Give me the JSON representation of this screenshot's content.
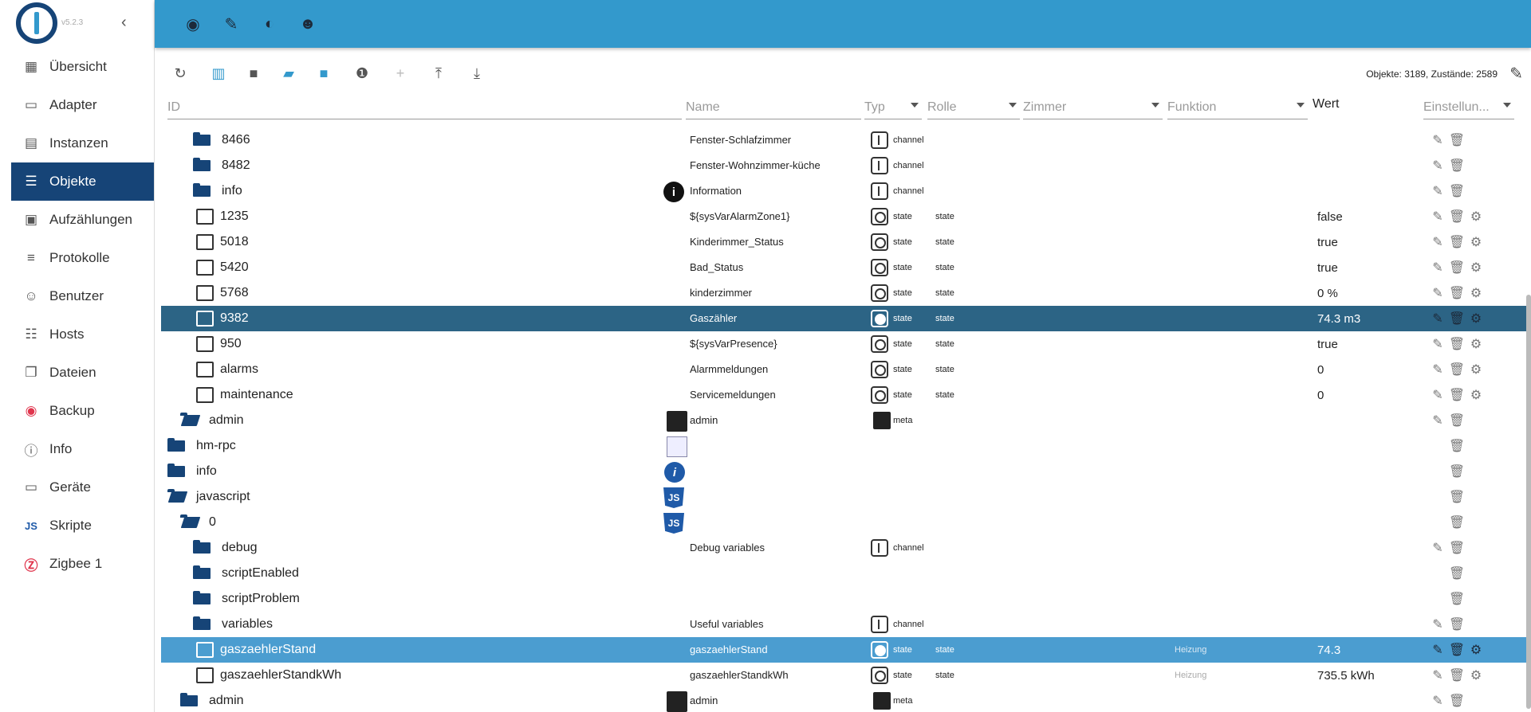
{
  "app": {
    "version": "v5.2.3"
  },
  "sidebar": {
    "items": [
      {
        "label": "Übersicht",
        "icon": "grid-icon"
      },
      {
        "label": "Adapter",
        "icon": "store-icon"
      },
      {
        "label": "Instanzen",
        "icon": "instances-icon"
      },
      {
        "label": "Objekte",
        "icon": "list-icon",
        "active": true
      },
      {
        "label": "Aufzählungen",
        "icon": "enums-icon"
      },
      {
        "label": "Protokolle",
        "icon": "logs-icon"
      },
      {
        "label": "Benutzer",
        "icon": "user-icon"
      },
      {
        "label": "Hosts",
        "icon": "hosts-icon"
      },
      {
        "label": "Dateien",
        "icon": "files-icon"
      },
      {
        "label": "Backup",
        "icon": "backup-icon"
      },
      {
        "label": "Info",
        "icon": "info-icon"
      },
      {
        "label": "Geräte",
        "icon": "devices-icon"
      },
      {
        "label": "Skripte",
        "icon": "js-icon"
      },
      {
        "label": "Zigbee 1",
        "icon": "zigbee-icon"
      }
    ]
  },
  "toolbar": {
    "counts": "Objekte: 3189, Zustände: 2589"
  },
  "headers": {
    "id": "ID",
    "name": "Name",
    "type": "Typ",
    "role": "Rolle",
    "room": "Zimmer",
    "function": "Funktion",
    "value": "Wert",
    "settings": "Einstellun..."
  },
  "rows": [
    {
      "id": "8466",
      "name": "Fenster-Schlafzimmer",
      "type": "channel",
      "role": "",
      "func": "",
      "value": ""
    },
    {
      "id": "8482",
      "name": "Fenster-Wohnzimmer-küche",
      "type": "channel",
      "role": "",
      "func": "",
      "value": ""
    },
    {
      "id": "info",
      "name": "Information",
      "type": "channel",
      "role": "",
      "func": "",
      "value": ""
    },
    {
      "id": "1235",
      "name": "${sysVarAlarmZone1}",
      "type": "state",
      "role": "state",
      "func": "",
      "value": "false"
    },
    {
      "id": "5018",
      "name": "Kinderimmer_Status",
      "type": "state",
      "role": "state",
      "func": "",
      "value": "true"
    },
    {
      "id": "5420",
      "name": "Bad_Status",
      "type": "state",
      "role": "state",
      "func": "",
      "value": "true"
    },
    {
      "id": "5768",
      "name": "kinderzimmer",
      "type": "state",
      "role": "state",
      "func": "",
      "value": "0 %"
    },
    {
      "id": "9382",
      "name": "Gaszähler",
      "type": "state",
      "role": "state",
      "func": "",
      "value": "74.3 m3"
    },
    {
      "id": "950",
      "name": "${sysVarPresence}",
      "type": "state",
      "role": "state",
      "func": "",
      "value": "true"
    },
    {
      "id": "alarms",
      "name": "Alarmmeldungen",
      "type": "state",
      "role": "state",
      "func": "",
      "value": "0"
    },
    {
      "id": "maintenance",
      "name": "Servicemeldungen",
      "type": "state",
      "role": "state",
      "func": "",
      "value": "0"
    },
    {
      "id": "admin",
      "name": "admin",
      "type": "meta",
      "role": "",
      "func": "",
      "value": ""
    },
    {
      "id": "hm-rpc",
      "name": "",
      "type": "",
      "role": "",
      "func": "",
      "value": ""
    },
    {
      "id": "info",
      "name": "",
      "type": "",
      "role": "",
      "func": "",
      "value": ""
    },
    {
      "id": "javascript",
      "name": "",
      "type": "",
      "role": "",
      "func": "",
      "value": ""
    },
    {
      "id": "0",
      "name": "",
      "type": "",
      "role": "",
      "func": "",
      "value": ""
    },
    {
      "id": "debug",
      "name": "Debug variables",
      "type": "channel",
      "role": "",
      "func": "",
      "value": ""
    },
    {
      "id": "scriptEnabled",
      "name": "",
      "type": "",
      "role": "",
      "func": "",
      "value": ""
    },
    {
      "id": "scriptProblem",
      "name": "",
      "type": "",
      "role": "",
      "func": "",
      "value": ""
    },
    {
      "id": "variables",
      "name": "Useful variables",
      "type": "channel",
      "role": "",
      "func": "",
      "value": ""
    },
    {
      "id": "gaszaehlerStand",
      "name": "gaszaehlerStand",
      "type": "state",
      "role": "state",
      "func": "Heizung",
      "value": "74.3"
    },
    {
      "id": "gaszaehlerStandkWh",
      "name": "gaszaehlerStandkWh",
      "type": "state",
      "role": "state",
      "func": "Heizung",
      "value": "735.5 kWh"
    },
    {
      "id": "admin",
      "name": "admin",
      "type": "meta",
      "role": "",
      "func": "",
      "value": ""
    }
  ]
}
